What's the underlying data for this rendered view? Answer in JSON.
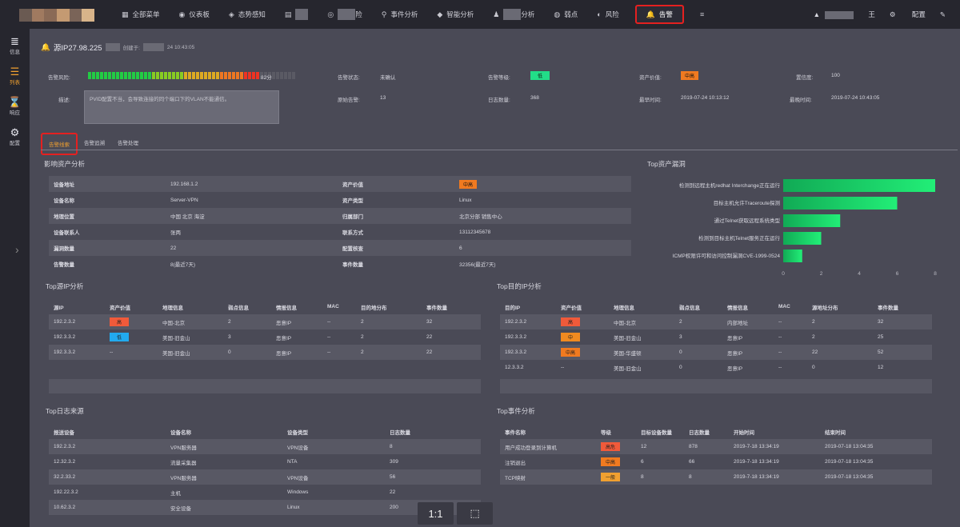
{
  "topbar": {
    "nav": [
      {
        "icon": "grid-icon",
        "glyph": "▦",
        "label": "全部菜单"
      },
      {
        "icon": "dashboard-icon",
        "glyph": "◉",
        "label": "仪表板"
      },
      {
        "icon": "cube-icon",
        "glyph": "◈",
        "label": "态势感知"
      },
      {
        "icon": "table-icon",
        "glyph": "▤",
        "label": ""
      },
      {
        "icon": "eye-icon",
        "glyph": "◎",
        "label": "险"
      },
      {
        "icon": "search-icon",
        "glyph": "⚲",
        "label": "事件分析"
      },
      {
        "icon": "diamond-icon",
        "glyph": "◆",
        "label": "智能分析"
      },
      {
        "icon": "person-icon",
        "glyph": "♟",
        "label": "分析"
      },
      {
        "icon": "target-icon",
        "glyph": "◍",
        "label": "弱点"
      },
      {
        "icon": "shield-icon",
        "glyph": "◐",
        "label": "风险"
      },
      {
        "icon": "bell-icon",
        "glyph": "🔔",
        "label": "告警"
      },
      {
        "icon": "menu-icon",
        "glyph": "≡",
        "label": ""
      }
    ],
    "right": {
      "user_suffix": "王",
      "config": "配置",
      "tool_glyph": "✎"
    }
  },
  "sidebar": [
    {
      "icon": "database-icon",
      "glyph": "≣",
      "label": "信息"
    },
    {
      "icon": "list-icon",
      "glyph": "☰",
      "label": "列表"
    },
    {
      "icon": "hourglass-icon",
      "glyph": "⌛",
      "label": "响应"
    },
    {
      "icon": "gear-icon",
      "glyph": "⚙",
      "label": "配置"
    }
  ],
  "header": {
    "title": "源IP27.98.225",
    "created_label": "创建于:",
    "created_suffix": "24 10:43:05"
  },
  "summary": {
    "risk_label": "告警风险:",
    "risk_value": "82分",
    "risk_score": 82,
    "status_label": "告警状态:",
    "status_value": "未确认",
    "level_label": "告警等级:",
    "level_value": "低",
    "asset_label": "资产价值:",
    "asset_value": "中高",
    "confidence_label": "置信度:",
    "confidence_value": "100",
    "desc_label": "描述:",
    "desc_value": "PVID配置不当，会导致连接的同个端口下的VLAN不能通信。",
    "raw_label": "原始告警:",
    "raw_value": "13",
    "log_label": "日志数量:",
    "log_value": "368",
    "first_label": "最早时间:",
    "first_value": "2019-07-24 10:13:12",
    "last_label": "最晚时间:",
    "last_value": "2019-07-24 10:43:05"
  },
  "tabs": [
    "告警线索",
    "告警追溯",
    "告警处理"
  ],
  "asset_section": {
    "title": "影响资产分析",
    "rows": [
      [
        "设备地址",
        "192.168.1.2",
        "资产价值",
        "中高"
      ],
      [
        "设备名称",
        "Server-VPN",
        "资产类型",
        "Linux"
      ],
      [
        "地理位置",
        "中国 北京 海淀",
        "归属部门",
        "北京分部 销售中心"
      ],
      [
        "设备联系人",
        "张两",
        "联系方式",
        "13112345678"
      ],
      [
        "漏洞数量",
        "22",
        "配置核查",
        "6"
      ],
      [
        "告警数量",
        "8(最近7天)",
        "事件数量",
        "32356(最近7天)"
      ]
    ]
  },
  "chart_data": {
    "type": "bar",
    "title": "Top资产漏洞",
    "orientation": "horizontal",
    "categories": [
      "检测到远程主机redhat Interchange正在运行",
      "目标主机允许Traceroute探测",
      "通过Telnet获取远程系统类型",
      "检测到目标主机Telnet服务正在运行",
      "ICMP权限许可和访问控制漏洞CVE-1999-0524"
    ],
    "values": [
      8,
      6,
      3,
      2,
      1
    ],
    "xlim": [
      0,
      8
    ],
    "ticks": [
      0,
      2,
      4,
      6,
      8
    ],
    "color": "#22cc66"
  },
  "src_section": {
    "title": "Top源IP分析",
    "headers": [
      "源IP",
      "资产价值",
      "地理信息",
      "弱点信息",
      "情报信息",
      "MAC",
      "目的地分布",
      "事件数量"
    ],
    "rows": [
      [
        "192.2.3.2",
        "高",
        "中国-北京",
        "2",
        "恶意IP",
        "--",
        "2",
        "32"
      ],
      [
        "192.3.3.2",
        "低",
        "美国-旧金山",
        "3",
        "恶意IP",
        "--",
        "2",
        "22"
      ],
      [
        "192.3.3.2",
        "--",
        "美国-旧金山",
        "0",
        "恶意IP",
        "--",
        "2",
        "22"
      ]
    ]
  },
  "dst_section": {
    "title": "Top目的IP分析",
    "headers": [
      "目的IP",
      "资产价值",
      "地理信息",
      "弱点信息",
      "情报信息",
      "MAC",
      "源地址分布",
      "事件数量"
    ],
    "rows": [
      [
        "192.2.3.2",
        "高",
        "中国-北京",
        "2",
        "内部地址",
        "--",
        "2",
        "32"
      ],
      [
        "192.3.3.2",
        "中",
        "美国-旧金山",
        "3",
        "恶意IP",
        "--",
        "2",
        "25"
      ],
      [
        "192.3.3.2",
        "中高",
        "美国-华盛顿",
        "0",
        "恶意IP",
        "--",
        "22",
        "52"
      ],
      [
        "12.3.3.2",
        "--",
        "美国-旧金山",
        "0",
        "恶意IP",
        "--",
        "0",
        "12"
      ]
    ]
  },
  "log_section": {
    "title": "Top日志来源",
    "headers": [
      "报送设备",
      "设备名称",
      "设备类型",
      "日志数量"
    ],
    "rows": [
      [
        "192.2.3.2",
        "VPN服务器",
        "VPN设备",
        "8"
      ],
      [
        "12.32.3.2",
        "流量采集器",
        "NTA",
        "309"
      ],
      [
        "32.2.33.2",
        "VPN服务器",
        "VPN设备",
        "56"
      ],
      [
        "192.22.3.2",
        "主机",
        "Windows",
        "22"
      ],
      [
        "10.62.3.2",
        "安全设备",
        "Linux",
        "200"
      ]
    ]
  },
  "event_section": {
    "title": "Top事件分析",
    "headers": [
      "事件名称",
      "等级",
      "目标设备数量",
      "日志数量",
      "开始时间",
      "结束时间"
    ],
    "rows": [
      [
        "用户成功登录到计算机",
        "高危",
        "12",
        "878",
        "2019-7-18 13:34:19",
        "2019-07-18 13:04:35"
      ],
      [
        "注销退出",
        "中高",
        "6",
        "66",
        "2019-7-18 13:34:19",
        "2019-07-18 13:04:35"
      ],
      [
        "TCP映射",
        "一般",
        "8",
        "8",
        "2019-7-18 13:34:19",
        "2019-07-18 13:04:35"
      ]
    ]
  },
  "zoom": {
    "ratio_label": "1:1",
    "fit_glyph": "⬚"
  }
}
